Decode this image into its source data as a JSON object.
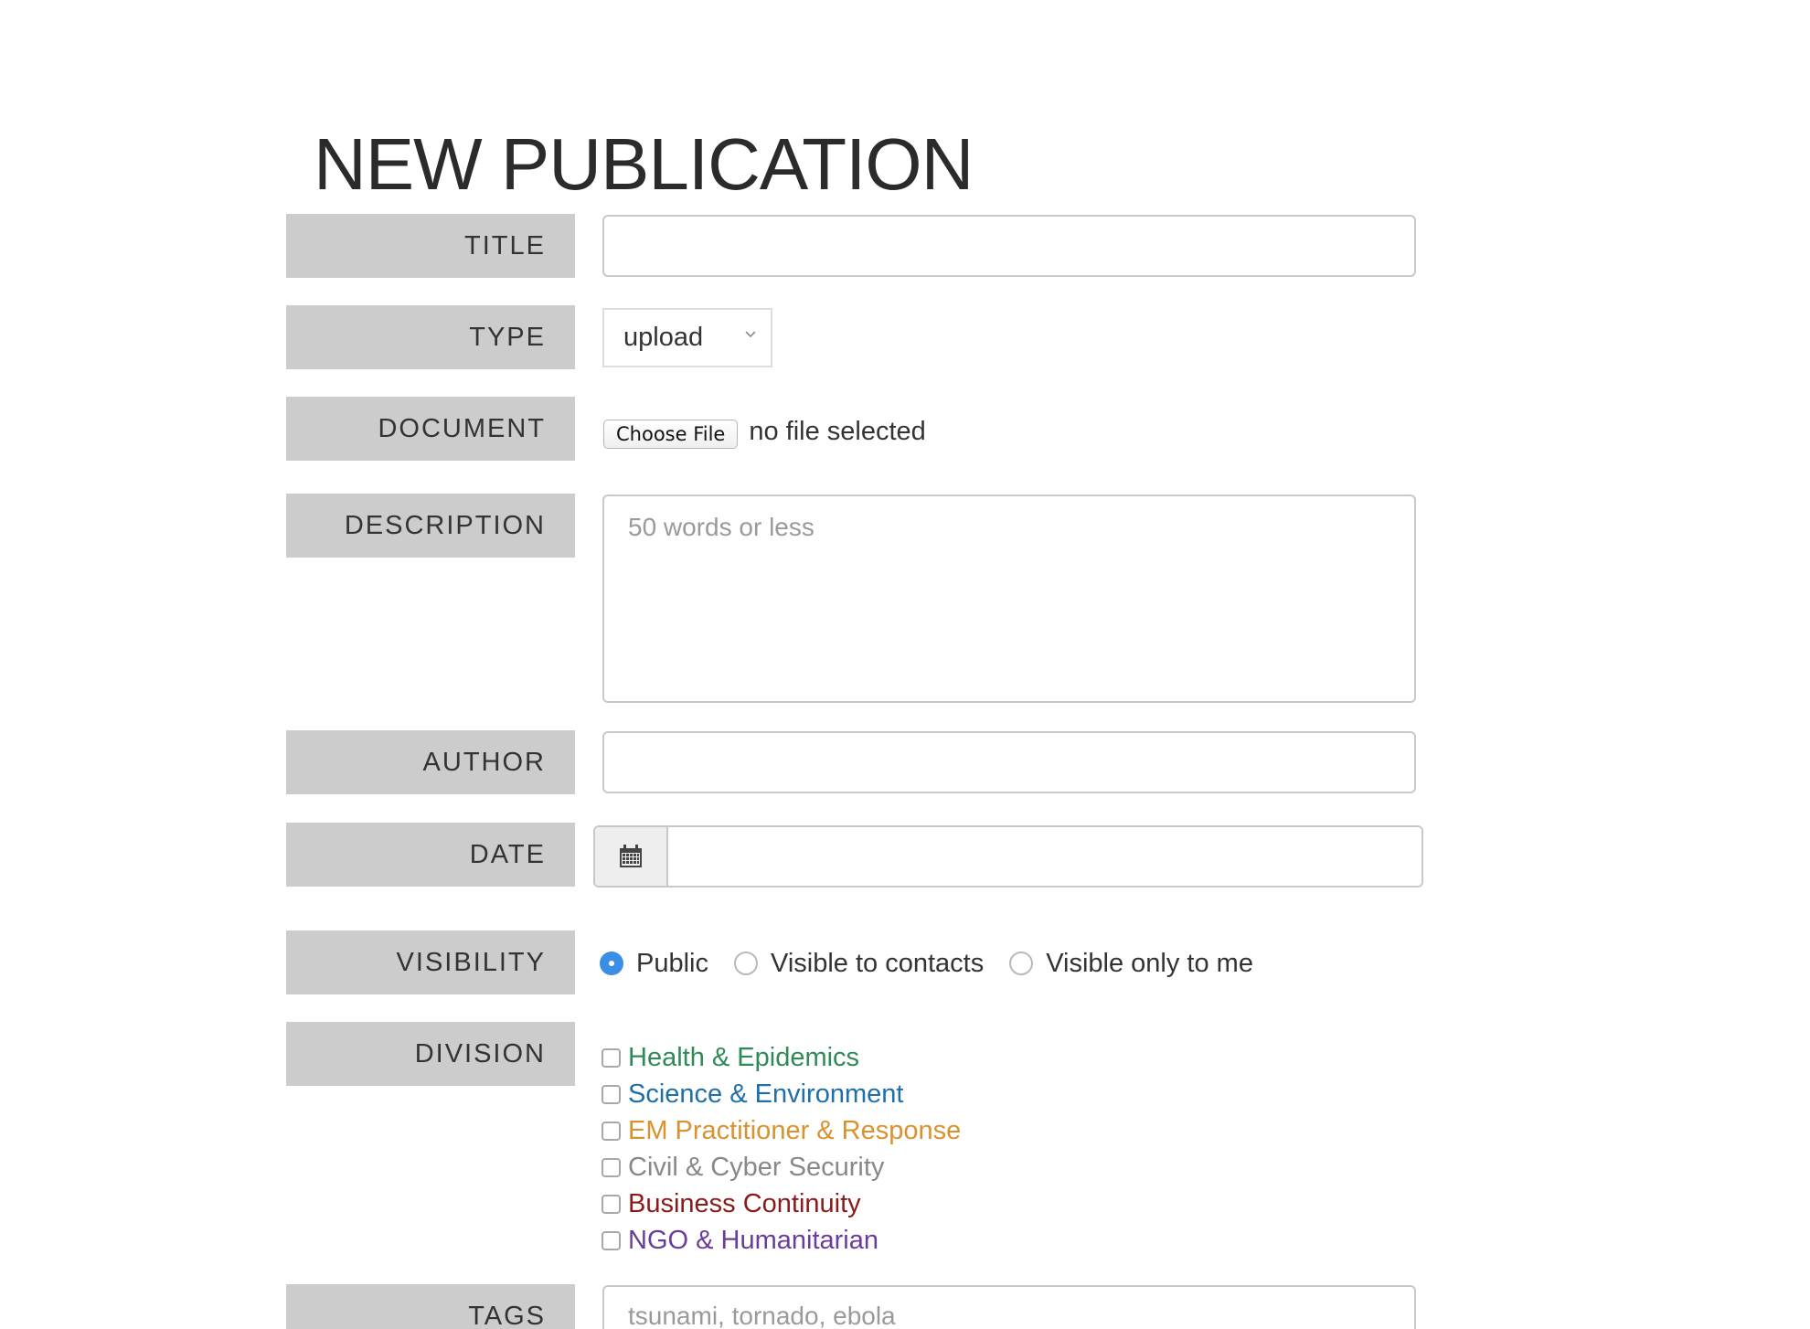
{
  "page": {
    "title": "NEW PUBLICATION"
  },
  "fields": {
    "title": {
      "label": "TITLE",
      "value": "",
      "placeholder": ""
    },
    "type": {
      "label": "TYPE",
      "selected": "upload"
    },
    "document": {
      "label": "DOCUMENT",
      "button_label": "Choose File",
      "status": "no file selected"
    },
    "description": {
      "label": "DESCRIPTION",
      "value": "",
      "placeholder": "50 words or less"
    },
    "author": {
      "label": "AUTHOR",
      "value": "",
      "placeholder": ""
    },
    "date": {
      "label": "DATE",
      "value": "",
      "icon": "calendar-icon"
    },
    "visibility": {
      "label": "VISIBILITY",
      "options": [
        {
          "label": "Public",
          "checked": true
        },
        {
          "label": "Visible to contacts",
          "checked": false
        },
        {
          "label": "Visible only to me",
          "checked": false
        }
      ]
    },
    "division": {
      "label": "DIVISION",
      "options": [
        {
          "label": "Health & Epidemics",
          "color": "#2e8b57",
          "checked": false
        },
        {
          "label": "Science & Environment",
          "color": "#1f6fa8",
          "checked": false
        },
        {
          "label": "EM Practitioner & Response",
          "color": "#d9922e",
          "checked": false
        },
        {
          "label": "Civil & Cyber Security",
          "color": "#888888",
          "checked": false
        },
        {
          "label": "Business Continuity",
          "color": "#8b1a1a",
          "checked": false
        },
        {
          "label": "NGO & Humanitarian",
          "color": "#6a3d9a",
          "checked": false
        }
      ]
    },
    "tags": {
      "label": "TAGS",
      "value": "",
      "placeholder": "tsunami, tornado, ebola"
    }
  },
  "colors": {
    "label_bg": "#cccccc",
    "radio_checked": "#3b8ee6",
    "border": "#c8c8c8"
  }
}
